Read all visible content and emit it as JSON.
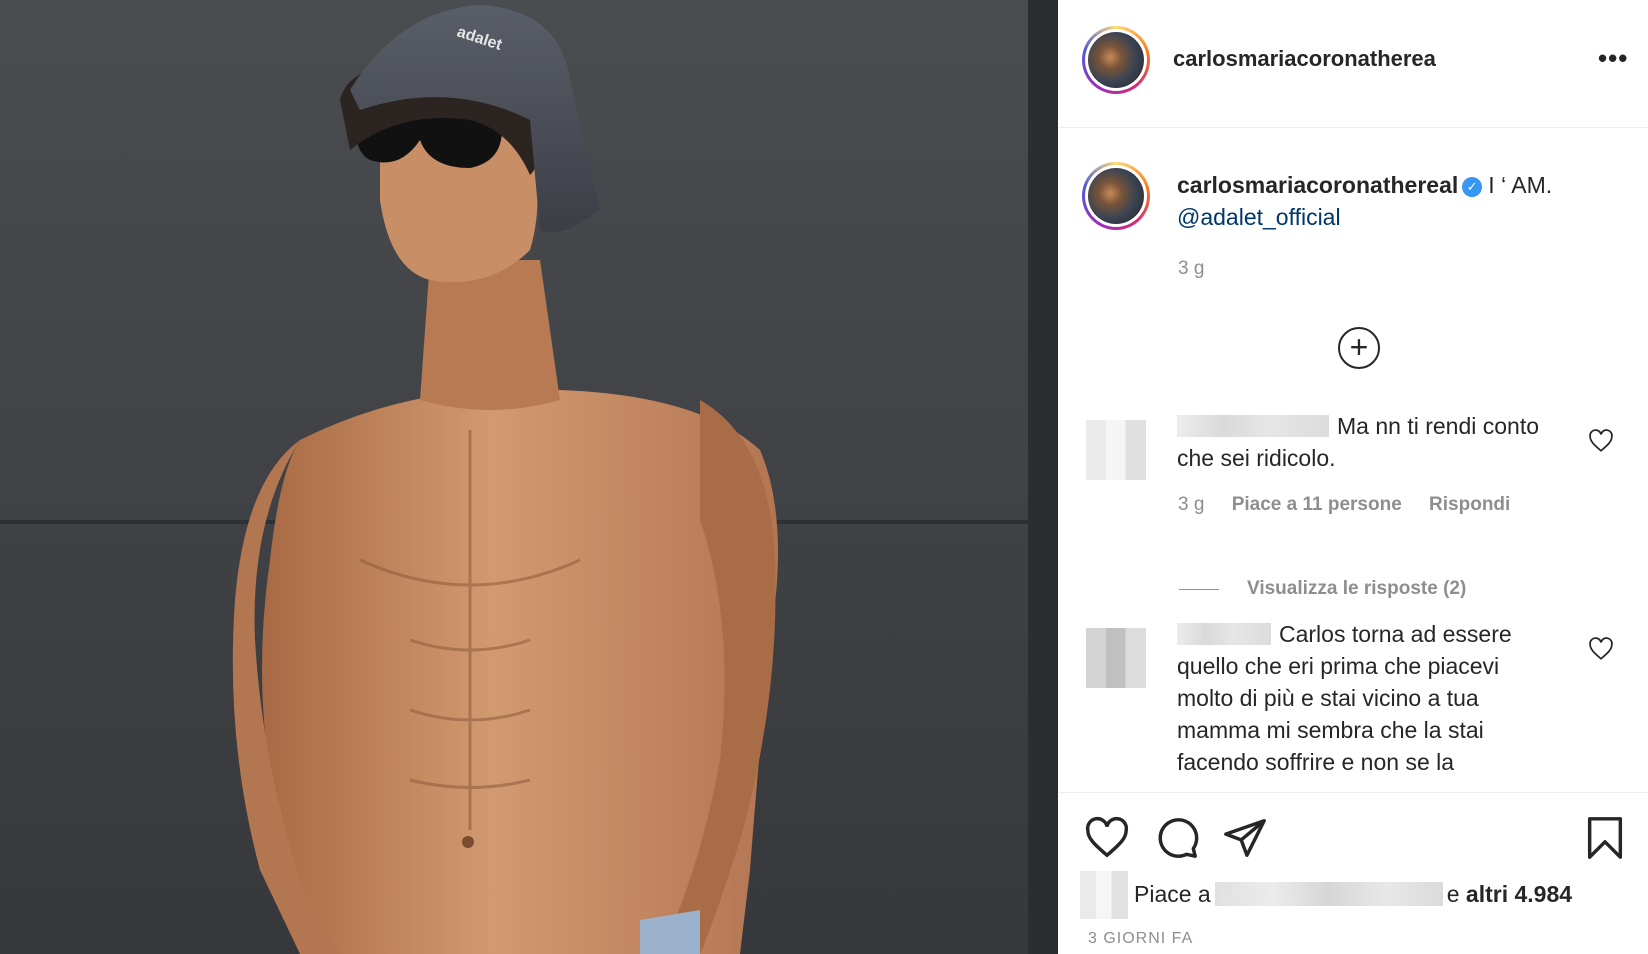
{
  "post": {
    "owner_username": "carlosmariacoronatherea",
    "more_label": "•••"
  },
  "caption": {
    "username": "carlosmariacoronathereal",
    "text": "I ‘ AM.",
    "mention": "@adalet_official",
    "time": "3 g"
  },
  "photo": {
    "hat_text": "adalet"
  },
  "comments": [
    {
      "text": "Ma nn ti rendi conto che sei ridicolo.",
      "time": "3 g",
      "likes": "Piace a 11 persone",
      "reply": "Rispondi",
      "view_replies": "Visualizza le risposte (2)"
    },
    {
      "text": "Carlos torna ad essere quello che eri prima che piacevi molto di più e stai vicino a tua mamma mi sembra che la stai facendo soffrire e non se la"
    }
  ],
  "actions": {
    "likes_prefix": "Piace a",
    "likes_suffix": "e",
    "likes_count": "altri 4.984",
    "date": "3 GIORNI FA"
  },
  "colors": {
    "link": "#00376b",
    "secondary_text": "#8e8e8e",
    "verified": "#3897f0"
  }
}
